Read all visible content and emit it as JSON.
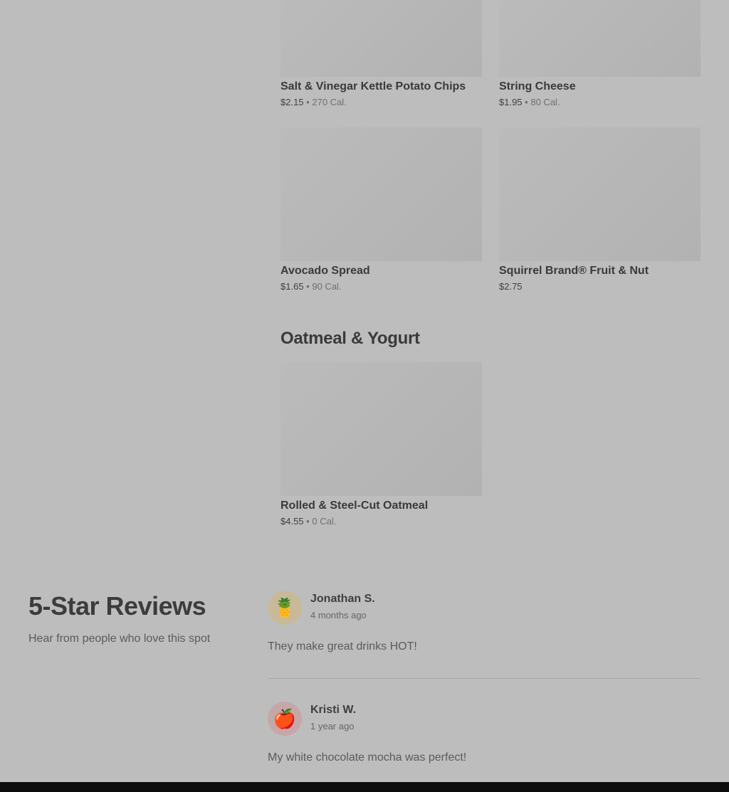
{
  "menu": {
    "items_row1": [
      {
        "name": "Salt & Vinegar Kettle Potato Chips",
        "price": "$2.15",
        "cal": "270 Cal."
      },
      {
        "name": "String Cheese",
        "price": "$1.95",
        "cal": "80 Cal."
      }
    ],
    "items_row2": [
      {
        "name": "Avocado Spread",
        "price": "$1.65",
        "cal": "90 Cal."
      },
      {
        "name": "Squirrel Brand® Fruit & Nut",
        "price": "$2.75",
        "cal": ""
      }
    ],
    "section_title": "Oatmeal & Yogurt",
    "items_row3": [
      {
        "name": "Rolled & Steel-Cut Oatmeal",
        "price": "$4.55",
        "cal": "0 Cal."
      }
    ],
    "separator": "•"
  },
  "reviews": {
    "title": "5-Star Reviews",
    "subtitle": "Hear from people who love this spot",
    "list": [
      {
        "name": "Jonathan S.",
        "time": "4 months ago",
        "text": "They make great drinks HOT!",
        "avatar_icon": "pineapple-icon",
        "avatar_glyph": "🍍"
      },
      {
        "name": "Kristi W.",
        "time": "1 year ago",
        "text": "My white chocolate mocha was perfect!",
        "avatar_icon": "apple-icon",
        "avatar_glyph": "🍎"
      }
    ]
  }
}
